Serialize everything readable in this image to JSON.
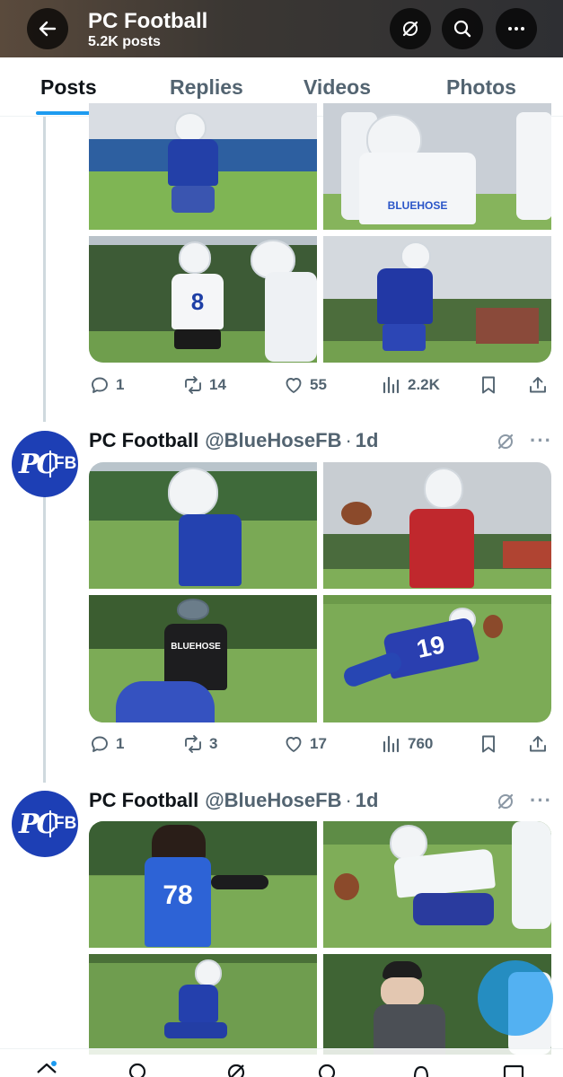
{
  "header": {
    "title": "PC Football",
    "subtitle": "5.2K posts",
    "back_icon": "arrow-left-icon",
    "grok_icon": "grok-icon",
    "search_icon": "search-icon",
    "more_icon": "more-horizontal-icon"
  },
  "tabs": [
    {
      "label": "Posts",
      "active": true
    },
    {
      "label": "Replies",
      "active": false
    },
    {
      "label": "Videos",
      "active": false
    },
    {
      "label": "Photos",
      "active": false
    }
  ],
  "posts": [
    {
      "actions": {
        "replies": "1",
        "reposts": "14",
        "likes": "55",
        "views": "2.2K"
      }
    },
    {
      "author": {
        "name": "PC Football",
        "handle": "@BlueHoseFB",
        "dot": "·",
        "time": "1d",
        "avatar_text_pc": "PC",
        "avatar_text_fb": "FB"
      },
      "more": "···",
      "actions": {
        "replies": "1",
        "reposts": "3",
        "likes": "17",
        "views": "760"
      }
    },
    {
      "author": {
        "name": "PC Football",
        "handle": "@BlueHoseFB",
        "dot": "·",
        "time": "1d",
        "avatar_text_pc": "PC",
        "avatar_text_fb": "FB"
      },
      "more": "···"
    }
  ],
  "jerseys": {
    "p1b": "8",
    "p2c": "19",
    "p3a": "78"
  },
  "colors": {
    "accent": "#1d9bf0",
    "brand_blue": "#1d3fb5",
    "text": "#0f1419",
    "muted": "#536471"
  }
}
